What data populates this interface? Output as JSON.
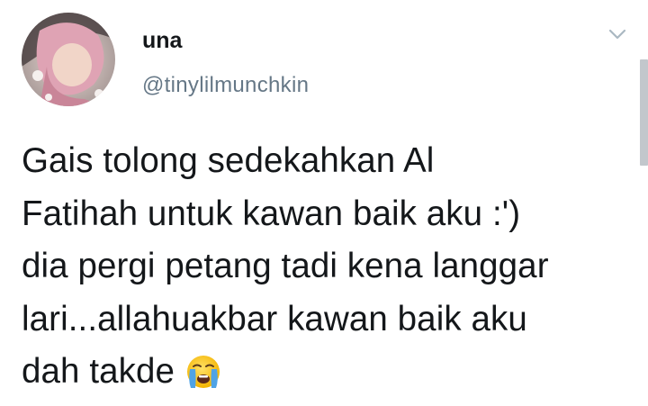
{
  "tweet": {
    "author": {
      "display_name": "una",
      "handle": "@tinylilmunchkin",
      "avatar_icon": "profile-avatar"
    },
    "menu_icon": "chevron-down-icon",
    "text_lines": [
      "Gais tolong sedekahkan Al",
      "Fatihah untuk kawan baik aku :')",
      "dia pergi petang tadi kena langgar",
      "lari...allahuakbar kawan baik aku",
      "dah takde"
    ],
    "emoji": "loudly-crying-face"
  },
  "colors": {
    "text": "#14171a",
    "secondary_text": "#657786",
    "chevron": "#aab8c2",
    "scrollbar": "#c2c7cc"
  }
}
